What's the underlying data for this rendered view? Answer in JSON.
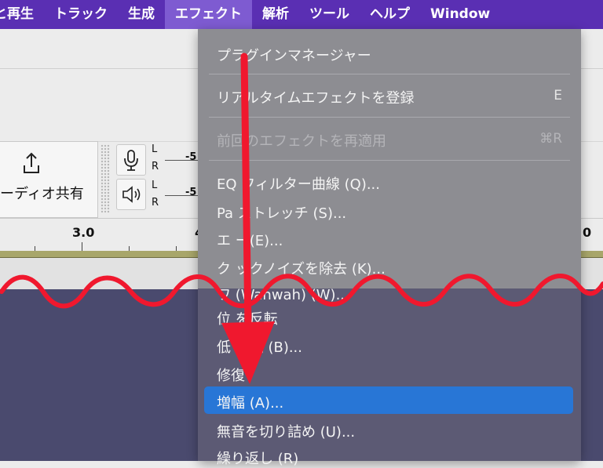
{
  "menubar": {
    "items": [
      {
        "label": "と再生"
      },
      {
        "label": "トラック"
      },
      {
        "label": "生成"
      },
      {
        "label": "エフェクト",
        "active": true
      },
      {
        "label": "解析"
      },
      {
        "label": "ツール"
      },
      {
        "label": "ヘルプ"
      },
      {
        "label": "Window"
      }
    ]
  },
  "toolbar": {
    "share_label": "ーディオ共有",
    "share_icon": "share-icon",
    "record_icon": "microphone-icon",
    "playback_icon": "speaker-icon",
    "meter_l": "L",
    "meter_r": "R",
    "meter_tick": "-5"
  },
  "ruler": {
    "labels": [
      "3.0",
      "4",
      "0"
    ]
  },
  "effects_menu": {
    "items": [
      {
        "label": "プラグインマネージャー",
        "shortcut": "",
        "disabled": false
      },
      {
        "label": "リアルタイムエフェクトを登録",
        "shortcut": "E",
        "disabled": false
      },
      {
        "label": "前回のエフェクトを再適用",
        "shortcut": "⌘R",
        "disabled": true
      },
      {
        "label": "EQ フィルター曲線 (Q)...",
        "shortcut": "",
        "disabled": false
      },
      {
        "label": "Pa  ストレッチ (S)...",
        "shortcut": "",
        "disabled": false
      },
      {
        "label": "エ  ー(E)...",
        "shortcut": "",
        "disabled": false
      },
      {
        "label": "ク  ックノイズを除去 (K)...",
        "shortcut": "",
        "disabled": false
      },
      {
        "label": "ワ  (Wahwah)  (W)...",
        "shortcut": "",
        "disabled": false
      },
      {
        "label": "位  を反転",
        "shortcut": "",
        "disabled": false
      },
      {
        "label": "低  高域 (B)...",
        "shortcut": "",
        "disabled": false
      },
      {
        "label": "修復",
        "shortcut": "",
        "disabled": false
      },
      {
        "label": "増幅 (A)...",
        "shortcut": "",
        "disabled": false,
        "highlighted": true
      },
      {
        "label": "無音を切り詰め (U)...",
        "shortcut": "",
        "disabled": false
      },
      {
        "label": "繰り返し (R)",
        "shortcut": "",
        "disabled": false
      }
    ]
  },
  "colors": {
    "menubar": "#5a2fb3",
    "highlight": "#2876d6",
    "annotation": "#f0182e"
  }
}
